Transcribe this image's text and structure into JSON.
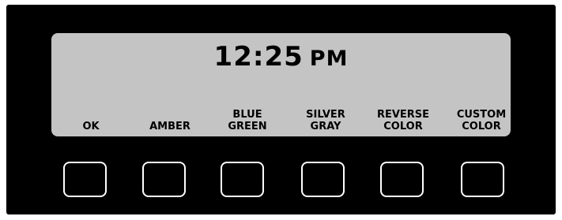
{
  "display": {
    "time": "12:25",
    "period": "PM"
  },
  "softkeys": [
    {
      "line1": "",
      "line2": "OK"
    },
    {
      "line1": "",
      "line2": "AMBER"
    },
    {
      "line1": "BLUE",
      "line2": "GREEN"
    },
    {
      "line1": "SILVER",
      "line2": "GRAY"
    },
    {
      "line1": "REVERSE",
      "line2": "COLOR"
    },
    {
      "line1": "CUSTOM",
      "line2": "COLOR"
    }
  ],
  "colors": {
    "bezel": "#000000",
    "screen": "#c4c4c4",
    "text": "#000000",
    "button_outline": "#ffffff"
  }
}
